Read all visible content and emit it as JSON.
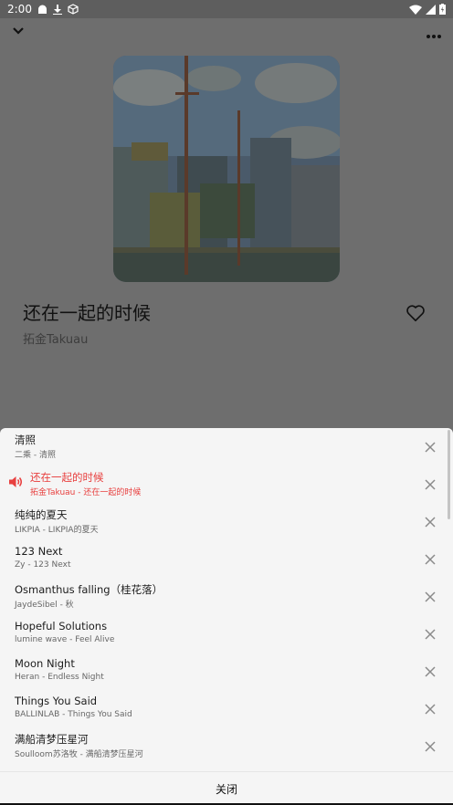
{
  "status_bar": {
    "time": "2:00",
    "left_icons": [
      "android-icon",
      "download-icon",
      "package-icon"
    ],
    "right_icons": [
      "wifi-icon",
      "signal-icon",
      "battery-icon"
    ]
  },
  "player": {
    "title": "还在一起的时候",
    "artist": "拓金Takuau",
    "collapse_icon": "chevron-down-icon",
    "more_icon": "more-horizontal-icon",
    "favorite_icon": "heart-outline-icon"
  },
  "queue": {
    "items": [
      {
        "title": "清照",
        "subtitle": "二乘 - 清照",
        "playing": false
      },
      {
        "title": "还在一起的时候",
        "subtitle": "拓金Takuau - 还在一起的时候",
        "playing": true
      },
      {
        "title": "纯纯的夏天",
        "subtitle": "LIKPIA - LIKPIA的夏天",
        "playing": false
      },
      {
        "title": "123 Next",
        "subtitle": "Zy - 123 Next",
        "playing": false
      },
      {
        "title": "Osmanthus falling（桂花落）",
        "subtitle": "JaydeSibel - 秋",
        "playing": false
      },
      {
        "title": "Hopeful Solutions",
        "subtitle": "lumine wave - Feel Alive",
        "playing": false
      },
      {
        "title": "Moon Night",
        "subtitle": "Heran - Endless Night",
        "playing": false
      },
      {
        "title": "Things You Said",
        "subtitle": "BALLINLAB - Things You Said",
        "playing": false
      },
      {
        "title": "满船清梦压星河",
        "subtitle": "Soulloom苏洛牧 - 满船清梦压星河",
        "playing": false
      }
    ],
    "close_label": "关闭"
  },
  "colors": {
    "accent": "#e8403f",
    "overlay": "#6e6e6e",
    "sheet": "#f5f5f5"
  }
}
